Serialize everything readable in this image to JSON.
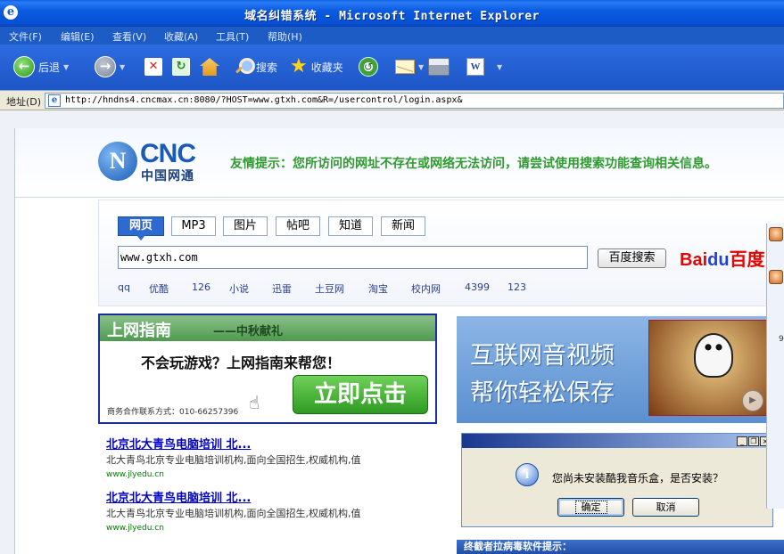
{
  "window": {
    "icon_letter": "e",
    "title": "域名纠错系统 - Microsoft Internet Explorer"
  },
  "menu": [
    "文件(F)",
    "编辑(E)",
    "查看(V)",
    "收藏(A)",
    "工具(T)",
    "帮助(H)"
  ],
  "toolbar": {
    "back_label": "后退",
    "search_label": "搜索",
    "favorites_label": "收藏夹",
    "icons": {
      "back": "back-arrow-icon",
      "forward": "forward-arrow-icon",
      "stop": "stop-icon",
      "refresh": "refresh-icon",
      "home": "home-icon",
      "search": "search-icon",
      "favorites": "star-icon",
      "media": "media-icon",
      "mail": "mail-icon",
      "print": "print-icon",
      "edit": "word-icon"
    },
    "glyphs": {
      "back": "←",
      "forward": "→",
      "stop": "✕",
      "refresh": "↻",
      "media": "↺",
      "edit": "W",
      "drop": "▼"
    }
  },
  "address": {
    "label": "地址(D)",
    "url": "http://hndns4.cncmax.cn:8080/?HOST=www.gtxh.com&R=/usercontrol/login.aspx&"
  },
  "header": {
    "logo_mark": "N",
    "logo_text": "CNC",
    "logo_subtitle": "中国网通",
    "hint": "友情提示：您所访问的网址不存在或网络无法访问，请尝试使用搜索功能查询相关信息。"
  },
  "search": {
    "tabs": [
      "网页",
      "MP3",
      "图片",
      "帖吧",
      "知道",
      "新闻"
    ],
    "active_tab": "网页",
    "query": "www.gtxh.com",
    "button": "百度搜索",
    "brand": {
      "left": "Bai",
      "paw": "du",
      "right": "百度"
    },
    "quick_links": [
      "qq",
      "优酷",
      "126",
      "小说",
      "迅雷",
      "土豆网",
      "淘宝",
      "校内网",
      "4399",
      "123"
    ]
  },
  "guide_ad": {
    "title": "上网指南",
    "subtitle": "——中秋献礼",
    "tagline": "不会玩游戏？上网指南来帮您！",
    "contact": "商务合作联系方式：010-66257396",
    "hand_glyph": "☝",
    "button": "立即点击"
  },
  "results": [
    {
      "title": "北京北大青鸟电脑培训 北...",
      "desc": "北大青鸟北京专业电脑培训机构,面向全国招生,权威机构,值",
      "url": "www.jlyedu.cn"
    },
    {
      "title": "北京北大青鸟电脑培训 北...",
      "desc": "北大青鸟北京专业电脑培训机构,面向全国招生,权威机构,值",
      "url": "www.jlyedu.cn"
    }
  ],
  "video_banner": {
    "line1": "互联网音视频",
    "line2": "帮你轻松保存",
    "play_glyph": "▶"
  },
  "dialog": {
    "controls": {
      "minimize": "_",
      "restore": "❐",
      "close": "×"
    },
    "info_glyph": "i",
    "message": "您尚未安装酷我音乐盒，是否安装？",
    "ok_button": "确定",
    "cancel_button": "取消"
  },
  "bottom_notice": "终截者拉病毒软件提示：",
  "edge": {
    "tail_char": "9"
  }
}
